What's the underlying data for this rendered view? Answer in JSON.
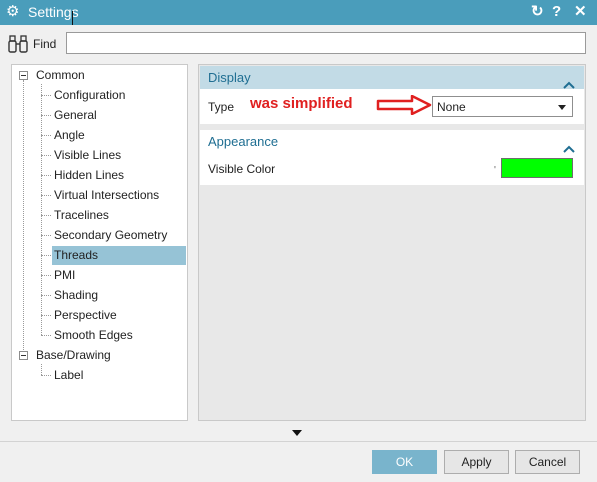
{
  "window": {
    "title": "Settings",
    "icon": "gear-icon",
    "controls": [
      {
        "name": "reset-icon",
        "glyph": "↻"
      },
      {
        "name": "help-icon",
        "glyph": "?"
      },
      {
        "name": "close-icon",
        "glyph": "✕"
      }
    ]
  },
  "find": {
    "label": "Find",
    "icon": "binoculars-icon",
    "value": ""
  },
  "tree": {
    "groups": [
      {
        "label": "Common",
        "expanded": true,
        "children": [
          "Configuration",
          "General",
          "Angle",
          "Visible Lines",
          "Hidden Lines",
          "Virtual Intersections",
          "Tracelines",
          "Secondary Geometry",
          "Threads",
          "PMI",
          "Shading",
          "Perspective",
          "Smooth Edges"
        ]
      },
      {
        "label": "Base/Drawing",
        "expanded": true,
        "children": [
          "Label"
        ]
      }
    ],
    "selected": "Threads"
  },
  "display": {
    "header": "Display",
    "type_label": "Type",
    "annotation": "was simplified",
    "type_value": "None"
  },
  "appearance": {
    "header": "Appearance",
    "visible_color_label": "Visible Color",
    "visible_color": "#00ff00"
  },
  "buttons": {
    "ok": "OK",
    "apply": "Apply",
    "cancel": "Cancel"
  },
  "colors": {
    "titlebar": "#4a9dbb",
    "section_header": "#c2dbe6",
    "selected_row": "#96c3d6",
    "ok_button": "#79b4cc",
    "annotation": "#e02020"
  }
}
